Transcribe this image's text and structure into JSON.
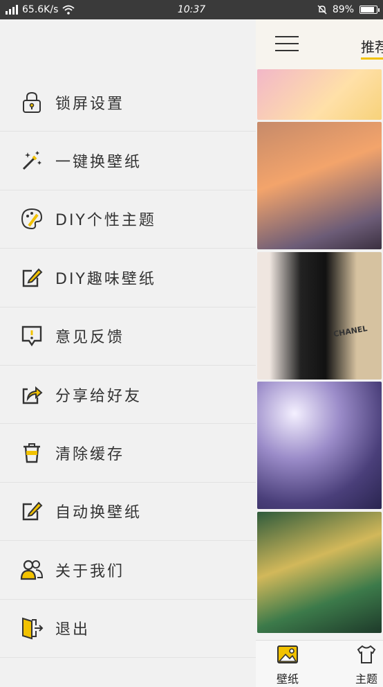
{
  "status_bar": {
    "network": "65.6K/s",
    "time": "10:37",
    "battery": "89%",
    "battery_level": 0.89
  },
  "drawer": {
    "menu": [
      {
        "label": "锁屏设置",
        "icon": "lock-icon"
      },
      {
        "label": "一键换壁纸",
        "icon": "magic-wand-icon"
      },
      {
        "label": "DIY个性主题",
        "icon": "palette-icon"
      },
      {
        "label": "DIY趣味壁纸",
        "icon": "edit-icon"
      },
      {
        "label": "意见反馈",
        "icon": "feedback-icon"
      },
      {
        "label": "分享给好友",
        "icon": "share-icon"
      },
      {
        "label": "清除缓存",
        "icon": "trash-icon"
      },
      {
        "label": "自动换壁纸",
        "icon": "edit-icon"
      },
      {
        "label": "关于我们",
        "icon": "users-icon"
      },
      {
        "label": "退出",
        "icon": "exit-icon"
      }
    ]
  },
  "content": {
    "tab_recommend": "推荐",
    "bottom_nav": {
      "wallpaper": "壁纸",
      "theme": "主题"
    }
  },
  "colors": {
    "accent": "#f2c200",
    "icon_stroke": "#333333"
  }
}
